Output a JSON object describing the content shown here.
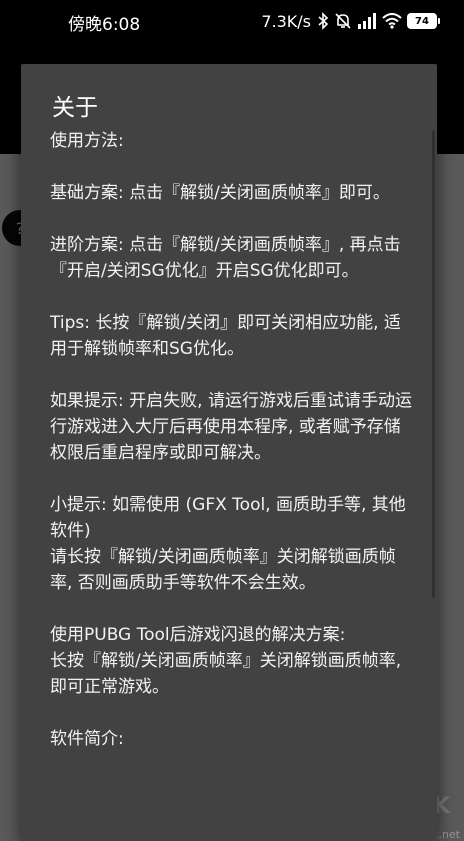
{
  "status_bar": {
    "time": "傍晚6:08",
    "network_speed": "7.3K/s",
    "icons": [
      "bluetooth-icon",
      "mute-icon",
      "signal-icon",
      "wifi-icon"
    ],
    "battery_level": "74"
  },
  "background_app": {
    "watermark": "www.kkx.net"
  },
  "dialog": {
    "title": "关于",
    "paragraphs": [
      "使用方法:",
      "基础方案: 点击『解锁/关闭画质帧率』即可。",
      "进阶方案: 点击『解锁/关闭画质帧率』, 再点击『开启/关闭SG优化』开启SG优化即可。",
      "Tips: 长按『解锁/关闭』即可关闭相应功能, 适用于解锁帧率和SG优化。",
      "如果提示: 开启失败, 请运行游戏后重试请手动运行游戏进入大厅后再使用本程序, 或者赋予存储权限后重启程序或即可解决。",
      "小提示: 如需使用 (GFX Tool, 画质助手等, 其他软件)\n请长按『解锁/关闭画质帧率』关闭解锁画质帧率, 否则画质助手等软件不会生效。",
      "使用PUBG Tool后游戏闪退的解决方案:\n长按『解锁/关闭画质帧率』关闭解锁画质帧率, 即可正常游戏。",
      "软件简介:"
    ]
  }
}
